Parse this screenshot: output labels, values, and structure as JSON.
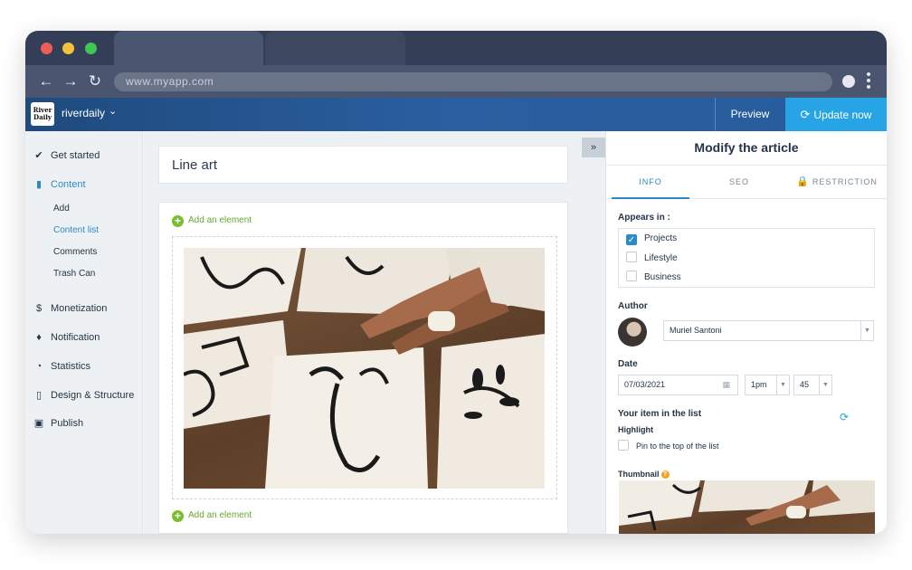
{
  "browser": {
    "url": "www.myapp.com"
  },
  "app": {
    "site_name": "riverdaily",
    "logo_text": "River Daily",
    "preview_label": "Preview",
    "update_label": "Update now"
  },
  "sidebar": {
    "items": [
      {
        "label": "Get started",
        "icon": "check-circle-icon"
      },
      {
        "label": "Content",
        "icon": "document-icon"
      },
      {
        "label": "Monetization",
        "icon": "dollar-icon"
      },
      {
        "label": "Notification",
        "icon": "bell-icon"
      },
      {
        "label": "Statistics",
        "icon": "pie-chart-icon"
      },
      {
        "label": "Design & Structure",
        "icon": "mobile-icon"
      },
      {
        "label": "Publish",
        "icon": "store-icon"
      }
    ],
    "content_sub": [
      "Add",
      "Content list",
      "Comments",
      "Trash Can"
    ]
  },
  "editor": {
    "title": "Line art",
    "add_element_label": "Add an element"
  },
  "panel": {
    "title": "Modify the article",
    "tabs": [
      "INFO",
      "SEO",
      "RESTRICTION"
    ],
    "appears_in_label": "Appears in :",
    "categories": [
      {
        "label": "Projects",
        "checked": true
      },
      {
        "label": "Lifestyle",
        "checked": false
      },
      {
        "label": "Business",
        "checked": false
      }
    ],
    "author_label": "Author",
    "author_value": "Muriel Santoni",
    "date_label": "Date",
    "date_value": "07/03/2021",
    "hour_value": "1pm",
    "minute_value": "45",
    "list_label": "Your item in the list",
    "highlight_label": "Highlight",
    "pin_label": "Pin to the top of the list",
    "thumbnail_label": "Thumbnail"
  },
  "colors": {
    "accent": "#2c8ac9",
    "update_button": "#26a4e6",
    "add_green": "#7bbd2e",
    "header_blue": "#2a5fa1"
  }
}
